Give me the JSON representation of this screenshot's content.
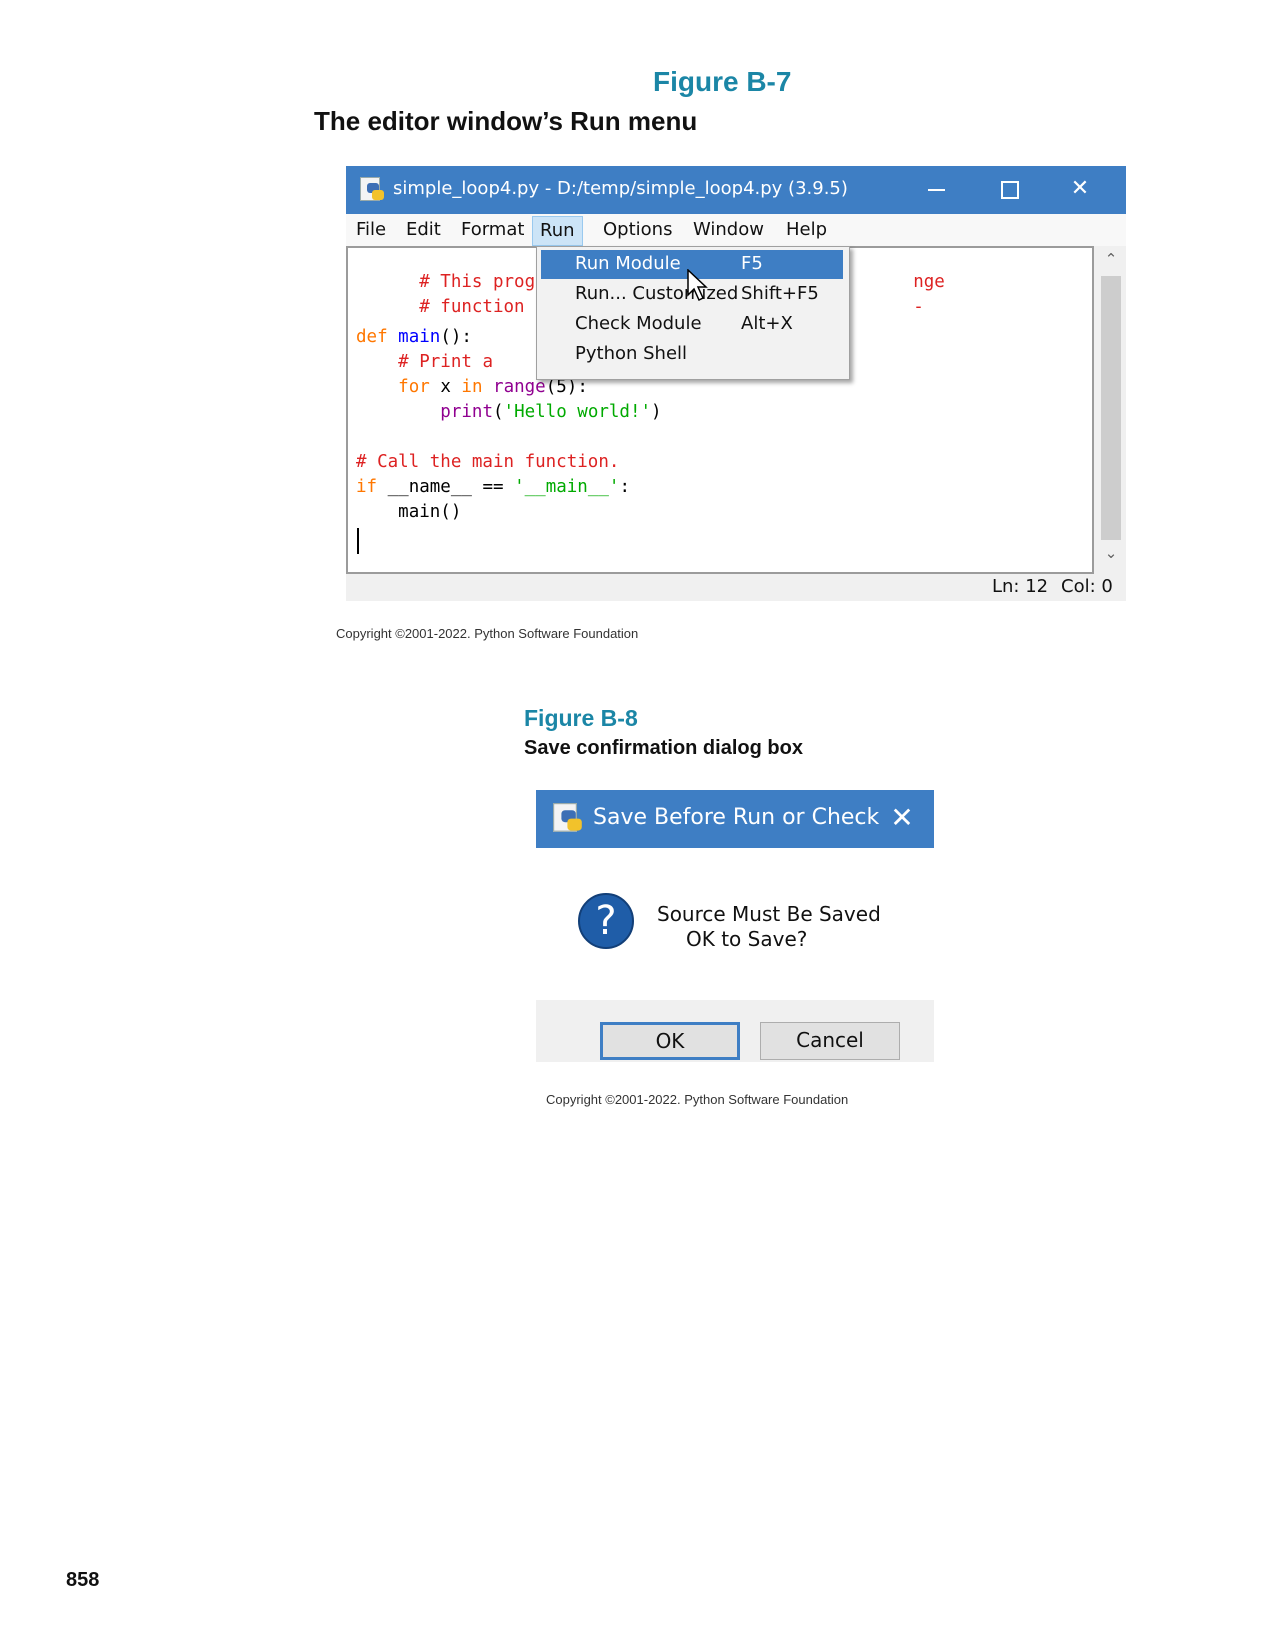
{
  "figure_b7": {
    "number": "Figure B-7",
    "caption": "The editor window’s Run menu",
    "copyright": "Copyright ©2001-2022. Python Software Foundation"
  },
  "editor": {
    "title": "simple_loop4.py - D:/temp/simple_loop4.py (3.9.5)",
    "menu": [
      "File",
      "Edit",
      "Format",
      "Run",
      "Options",
      "Window",
      "Help"
    ],
    "code": {
      "line1_comment": "# This program",
      "line1_tail": "nge",
      "line2_comment": "# function can",
      "line2_tail": "-",
      "def_kw": "def",
      "def_name": "main",
      "def_rest": "():",
      "print_comment": "# Print a",
      "for_kw": "for",
      "for_x": "x",
      "in_kw": "in",
      "range_fn": "range",
      "range_args": "(5):",
      "print_fn": "print",
      "print_open": "(",
      "print_str": "'Hello world!'",
      "print_close": ")",
      "call_comment": "# Call the main function.",
      "if_kw": "if",
      "if_name": "__name__",
      "if_eq": "==",
      "if_str": "'__main__'",
      "if_colon": ":",
      "main_call": "main()"
    },
    "status": {
      "ln": "Ln: 12",
      "col": "Col: 0"
    },
    "run_menu": [
      {
        "label": "Run Module",
        "shortcut": "F5",
        "highlighted": true
      },
      {
        "label": "Run... Customized",
        "shortcut": "Shift+F5",
        "highlighted": false
      },
      {
        "label": "Check Module",
        "shortcut": "Alt+X",
        "highlighted": false
      },
      {
        "label": "Python Shell",
        "shortcut": "",
        "highlighted": false
      }
    ]
  },
  "figure_b8": {
    "number": "Figure B-8",
    "caption": "Save confirmation dialog box",
    "copyright": "Copyright ©2001-2022. Python Software Foundation"
  },
  "dialog": {
    "title": "Save Before Run or Check",
    "message_line1": "Source Must Be Saved",
    "message_line2": "OK to Save?",
    "ok_label": "OK",
    "cancel_label": "Cancel",
    "question_glyph": "?"
  },
  "page_number": "858",
  "colors": {
    "figure_number": "#1b86a6",
    "titlebar": "#3e7ec4",
    "comment": "#dd2222",
    "keyword": "#ff7700",
    "string": "#00aa00",
    "builtin": "#900090"
  }
}
